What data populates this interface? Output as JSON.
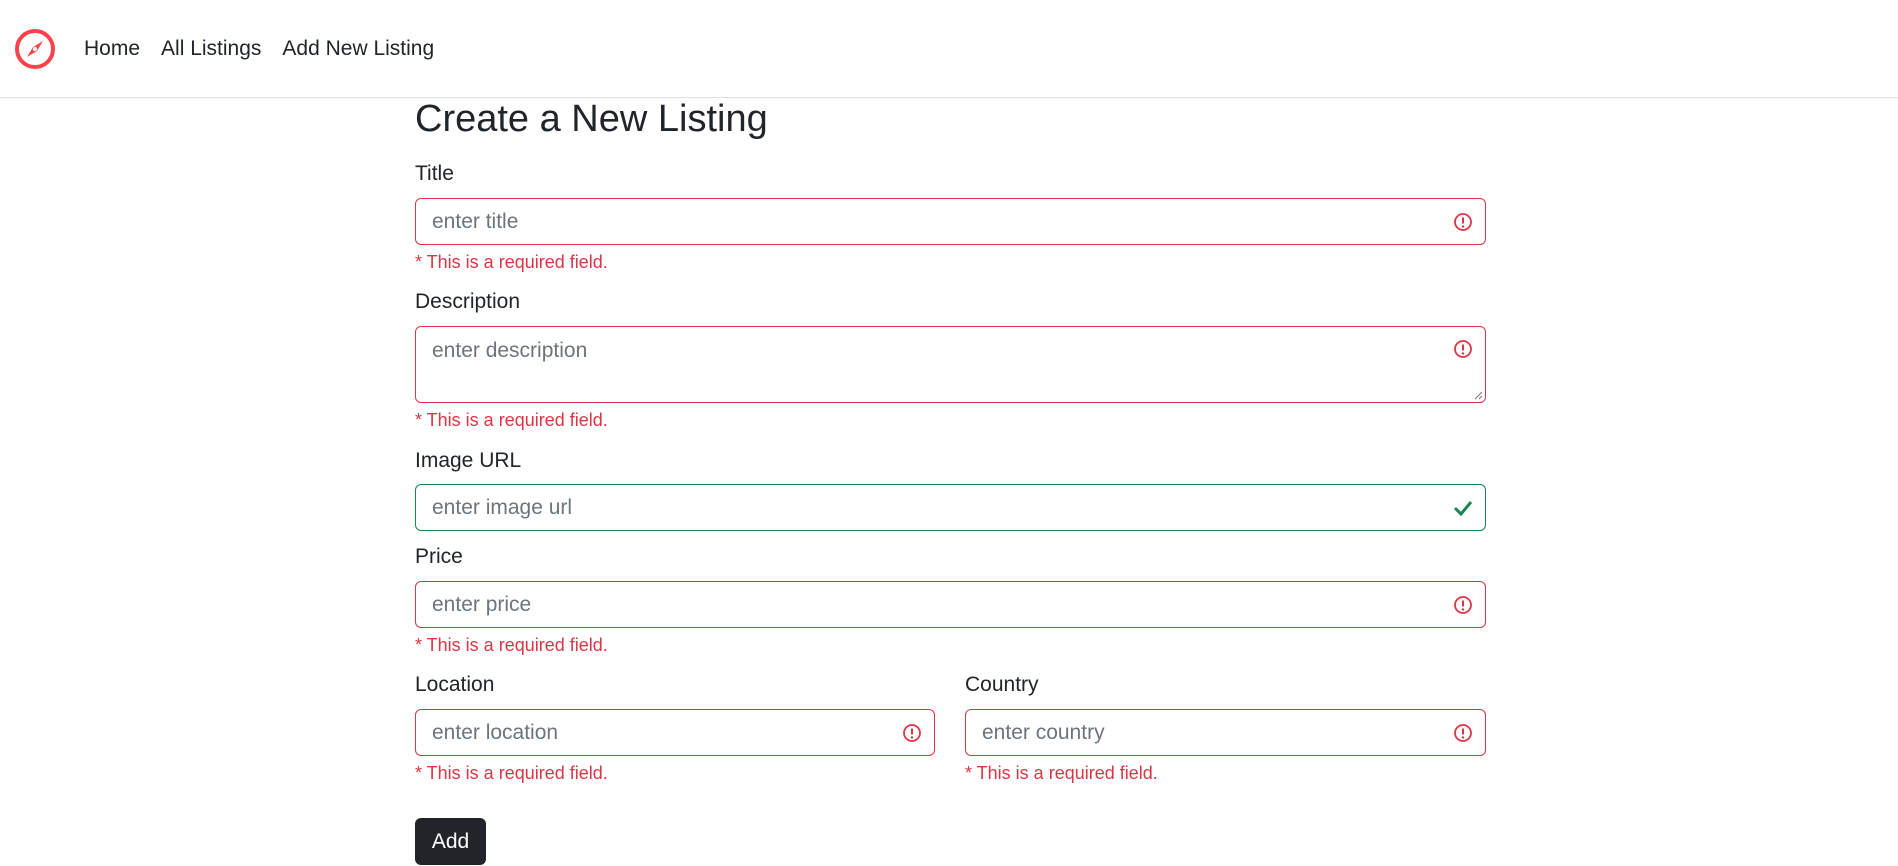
{
  "navbar": {
    "brand_icon": "compass-icon",
    "brand_color": "#fe424d",
    "links": [
      {
        "label": "Home"
      },
      {
        "label": "All Listings"
      },
      {
        "label": "Add New Listing"
      }
    ]
  },
  "form": {
    "title": "Create a New Listing",
    "fields": {
      "title": {
        "label": "Title",
        "placeholder": "enter title",
        "state": "invalid",
        "error": "* This is a required field."
      },
      "description": {
        "label": "Description",
        "placeholder": "enter description",
        "state": "invalid",
        "error": "* This is a required field."
      },
      "image_url": {
        "label": "Image URL",
        "placeholder": "enter image url",
        "state": "valid"
      },
      "price": {
        "label": "Price",
        "placeholder": "enter price",
        "state": "invalid",
        "error": "* This is a required field."
      },
      "location": {
        "label": "Location",
        "placeholder": "enter location",
        "state": "invalid",
        "error": "* This is a required field."
      },
      "country": {
        "label": "Country",
        "placeholder": "enter country",
        "state": "invalid",
        "error": "* This is a required field."
      }
    },
    "submit_label": "Add"
  },
  "colors": {
    "invalid": "#dc3545",
    "valid": "#198754",
    "button_bg": "#212529"
  }
}
